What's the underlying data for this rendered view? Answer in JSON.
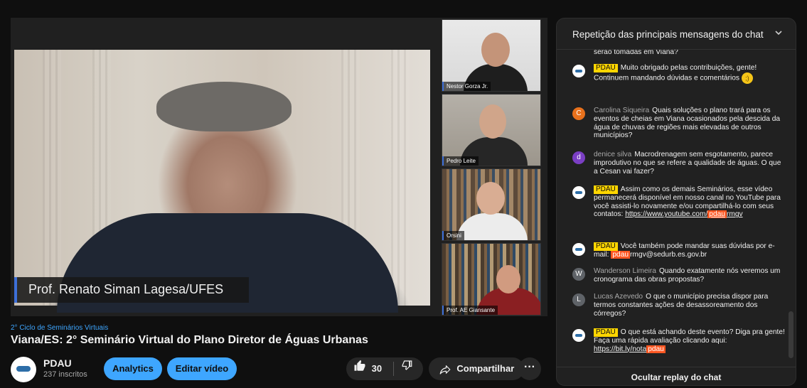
{
  "video": {
    "main_speaker": "Prof. Renato Siman Lagesa/UFES",
    "participants": [
      "Nestor Gorza Jr.",
      "Pedro Leite",
      "Orsini",
      "Prof. AE Giansante"
    ]
  },
  "meta": {
    "series": "2° Ciclo de Seminários Virtuais",
    "title": "Viana/ES: 2° Seminário Virtual do Plano Diretor de Águas Urbanas"
  },
  "channel": {
    "name": "PDAU",
    "subscribers": "237 inscritos"
  },
  "actions": {
    "analytics": "Analytics",
    "edit": "Editar vídeo",
    "likes": "30",
    "share": "Compartilhar",
    "more": "···"
  },
  "chat": {
    "header": "Repetição das principais mensagens do chat",
    "footer": "Ocultar replay do chat",
    "messages": [
      {
        "text": "serão tomadas em Viana?"
      },
      {
        "badge": "PDAU",
        "text": "Muito obrigado pelas contribuições, gente! Continuem mandando dúvidas e comentários"
      },
      {
        "author": "Carolina Siqueira",
        "initial": "C",
        "text": "Quais soluções o plano trará para os eventos de cheias em Viana ocasionados pela descida da água de chuvas de regiões mais elevadas de outros municípios?"
      },
      {
        "author": "denice silva",
        "initial": "d",
        "text": "Macrodrenagem sem esgotamento, parece improdutivo no que se refere a qualidade de águas. O que a Cesan vai fazer?"
      },
      {
        "badge": "PDAU",
        "text": "Assim como os demais Seminários, esse vídeo permanecerá disponível em nosso canal no YouTube para você assisti-lo novamente e/ou compartilhá-lo com seus contatos:",
        "link_a": "https://www.yo",
        "link_b": "utube.com/",
        "link_hl": "pdau",
        "link_c": "rmgv"
      },
      {
        "badge": "PDAU",
        "text": "Você também pode mandar suas dúvidas por e-mail:",
        "hl": "pdau",
        "email": "rmgv@sedurb.es.gov.br"
      },
      {
        "author": "Wanderson Limeira",
        "initial": "W",
        "text": "Quando exatamente nós veremos um cronograma das obras propostas?"
      },
      {
        "author": "Lucas Azevedo",
        "initial": "L",
        "text": "O que o município precisa dispor para termos constantes ações de desassoreamento dos córregos?"
      },
      {
        "badge": "PDAU",
        "text": "O que está achando deste evento? Diga pra gente! Faça uma rápida avaliação clicando aqui:",
        "link": "https://bit.ly/nota",
        "hl": "pdau"
      }
    ]
  },
  "colors": {
    "accent": "#3ea6ff",
    "badge": "#ffd600",
    "highlight": "#ff5722",
    "avatar_c": "#e8711c",
    "avatar_d": "#7b3fc4",
    "avatar_w": "#5f6368",
    "avatar_l": "#5f6368"
  }
}
